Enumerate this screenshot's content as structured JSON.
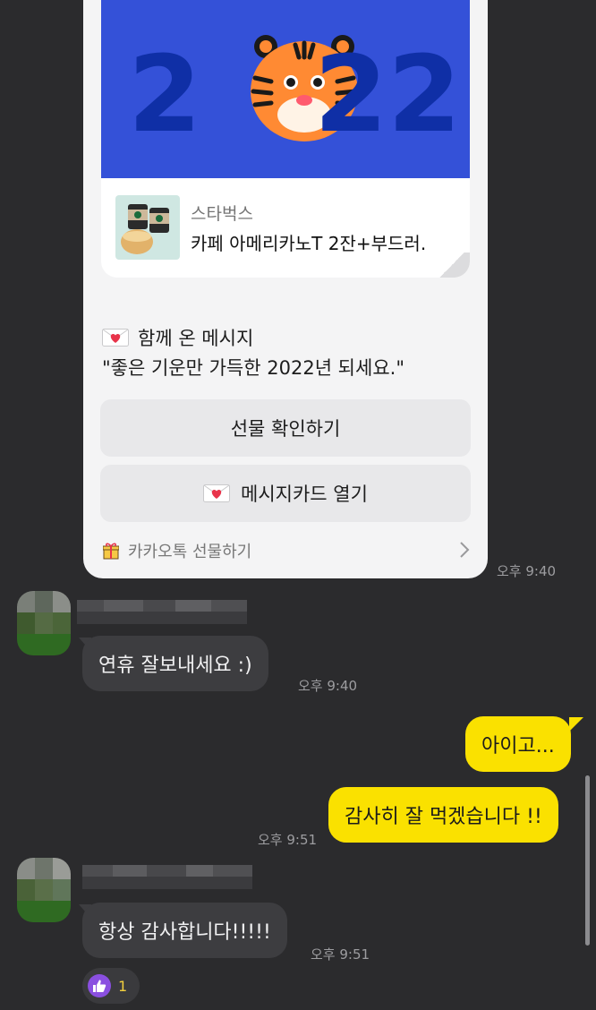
{
  "gift": {
    "brand": "스타벅스",
    "product": "카페 아메리카노T 2잔+부드러.",
    "banner_year": "2022",
    "message_heading": "함께 온 메시지",
    "message_text": "\"좋은 기운만 가득한 2022년 되세요.\"",
    "check_gift_label": "선물 확인하기",
    "open_card_label": "메시지카드 열기",
    "footer_label": "카카오톡 선물하기",
    "time": "오후 9:40"
  },
  "messages": [
    {
      "side": "them",
      "text": "연휴 잘보내세요 :)",
      "time": "오후 9:40"
    },
    {
      "side": "me",
      "text": "아이고...",
      "time": ""
    },
    {
      "side": "me",
      "text": "감사히 잘 먹겠습니다 !!",
      "time": "오후 9:51"
    },
    {
      "side": "them",
      "text": "항상 감사합니다!!!!!",
      "time": "오후 9:51"
    }
  ],
  "reaction": {
    "icon": "thumbs-up-icon",
    "count": "1",
    "color": "#8a4fe0"
  },
  "colors": {
    "background": "#2b2b2d",
    "my_bubble": "#fae100",
    "their_bubble": "#3d3d40",
    "banner": "#3451d8"
  }
}
